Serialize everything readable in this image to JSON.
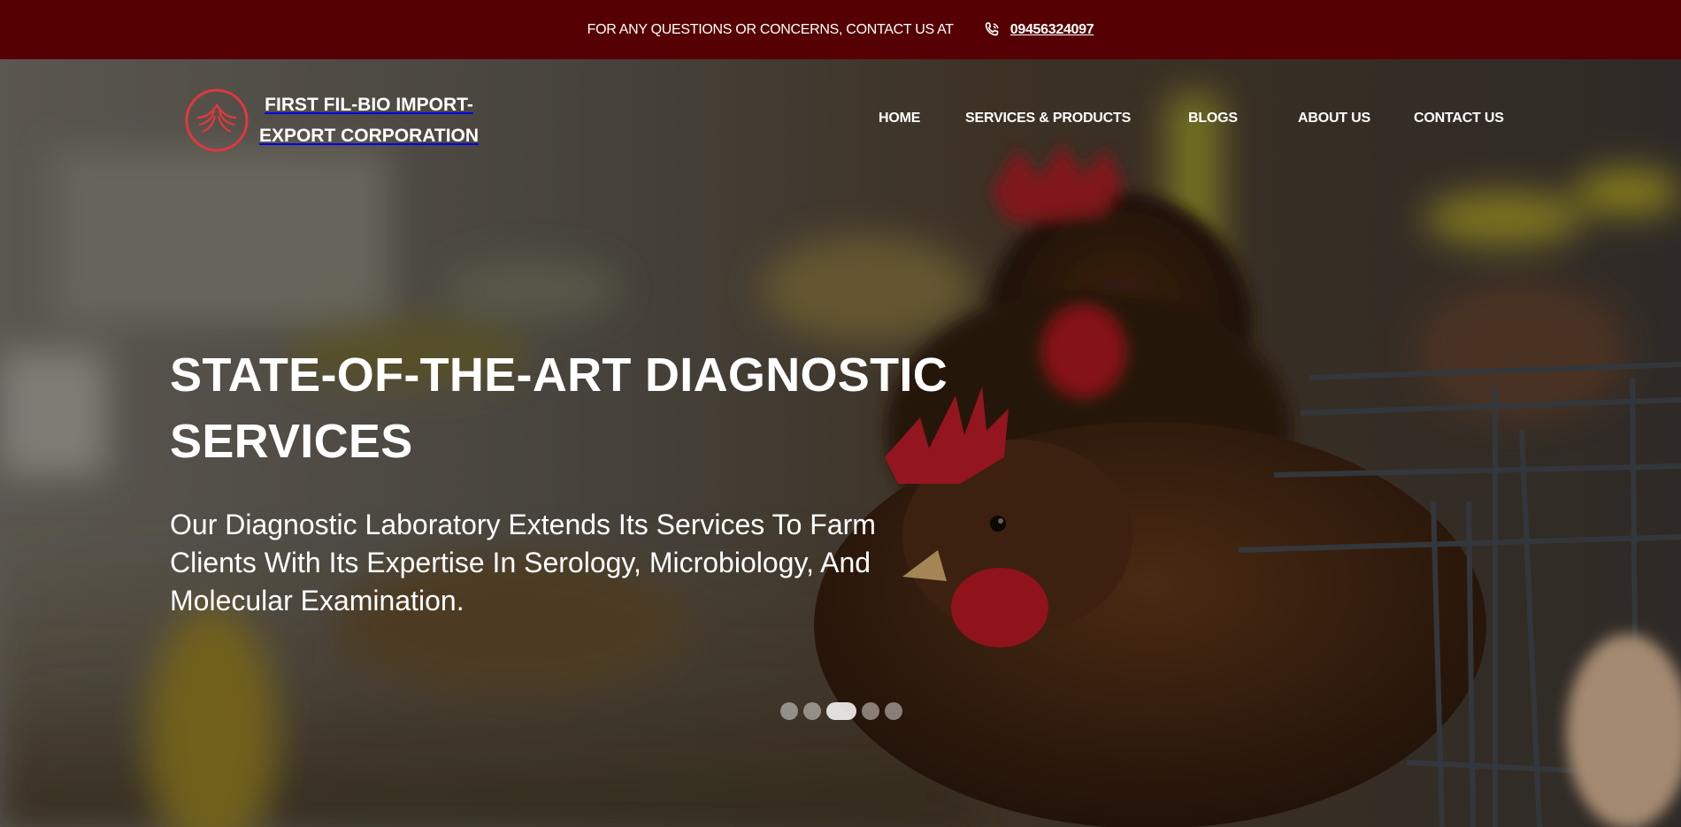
{
  "topbar": {
    "message": "FOR ANY QUESTIONS OR CONCERNS, CONTACT US AT",
    "phone": "09456324097",
    "icon": "phone-icon",
    "background": "#550002"
  },
  "brand": {
    "name": "FIRST FIL-BIO IMPORT-EXPORT CORPORATION",
    "logo_color": "#e0383c"
  },
  "nav": {
    "items": [
      {
        "label": "HOME"
      },
      {
        "label": "SERVICES & PRODUCTS"
      },
      {
        "label": "BLOGS"
      },
      {
        "label": "ABOUT US"
      },
      {
        "label": "CONTACT US"
      }
    ]
  },
  "hero": {
    "headline": "STATE-OF-THE-ART DIAGNOSTIC SERVICES",
    "subtext": "Our Diagnostic Laboratory Extends Its Services To Farm Clients With Its Expertise In Serology, Microbiology, And Molecular Examination.",
    "slider": {
      "total": 5,
      "active": 3
    }
  }
}
